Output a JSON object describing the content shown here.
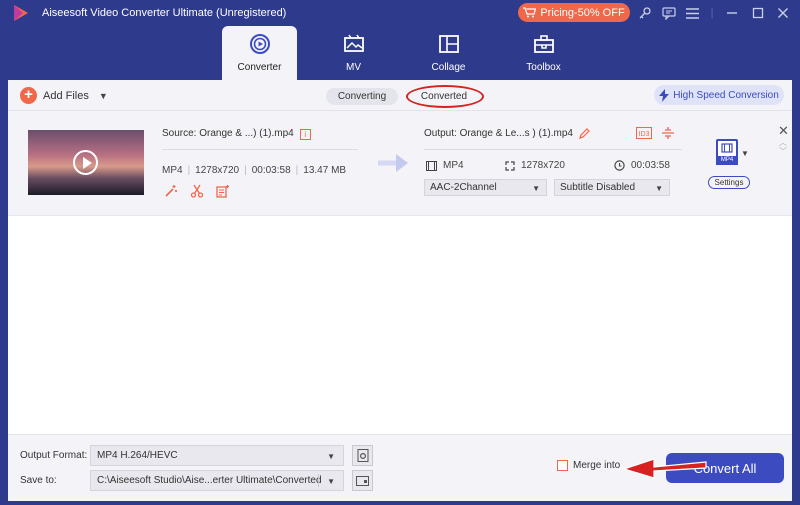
{
  "app": {
    "title": "Aiseesoft Video Converter Ultimate (Unregistered)",
    "pricing_label": "Pricing-50% OFF",
    "colors": {
      "chrome": "#2e3a8c",
      "accent": "#f0674a",
      "primary": "#3c4cc0",
      "highlight_annotation": "#d32424"
    }
  },
  "window_controls": [
    "key-icon",
    "chat-icon",
    "menu-icon",
    "minimize-icon",
    "maximize-icon",
    "close-icon"
  ],
  "tabs": [
    {
      "label": "Converter",
      "icon": "converter-icon",
      "active": true
    },
    {
      "label": "MV",
      "icon": "mv-icon",
      "active": false
    },
    {
      "label": "Collage",
      "icon": "collage-icon",
      "active": false
    },
    {
      "label": "Toolbox",
      "icon": "toolbox-icon",
      "active": false
    }
  ],
  "toolbar": {
    "add_files_label": "Add Files",
    "segments": [
      "Converting",
      "Converted"
    ],
    "selected_segment": "Converted",
    "high_speed_label": "High Speed Conversion"
  },
  "file": {
    "source_name": "Source: Orange & ...) (1).mp4",
    "source_format": "MP4",
    "source_resolution": "1278x720",
    "source_duration": "00:03:58",
    "source_size": "13.47 MB",
    "output_name": "Output: Orange & Le...s ) (1).mp4",
    "output_format": "MP4",
    "output_resolution": "1278x720",
    "output_duration": "00:03:58",
    "audio_track": "AAC-2Channel",
    "subtitle": "Subtitle Disabled",
    "format_badge": "MP4",
    "settings_label": "Settings"
  },
  "bottom": {
    "output_format_label": "Output Format:",
    "output_format_value": "MP4 H.264/HEVC",
    "save_to_label": "Save to:",
    "save_to_value": "C:\\Aiseesoft Studio\\Aise...erter Ultimate\\Converted",
    "merge_label": "Merge into",
    "merge_checked": false,
    "convert_all_label": "Convert All"
  }
}
